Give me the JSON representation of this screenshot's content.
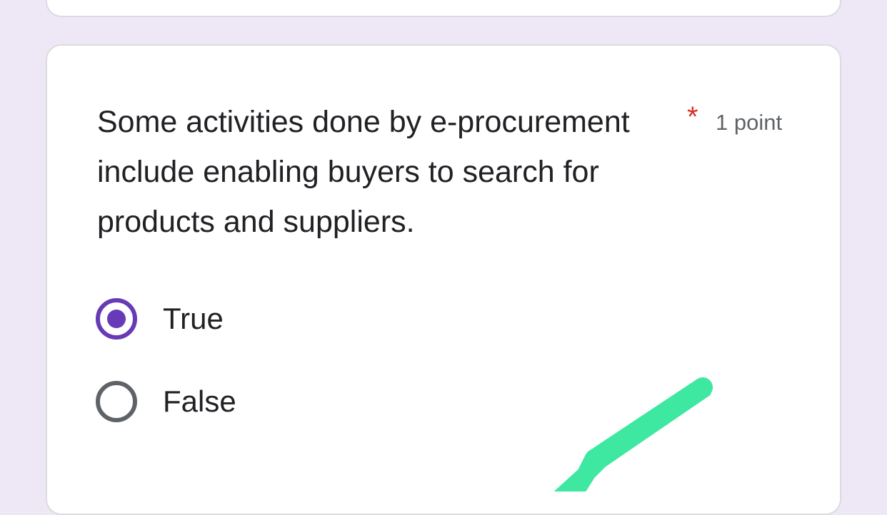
{
  "question": {
    "text": "Some activities done by e-procurement include enabling buyers to search for products and suppliers.",
    "required_marker": "*",
    "points": "1 point"
  },
  "options": [
    {
      "label": "True",
      "selected": true
    },
    {
      "label": "False",
      "selected": false
    }
  ],
  "colors": {
    "page_background": "#ede7f6",
    "accent": "#673ab7",
    "required": "#d93025",
    "marker": "#3ee8a0"
  },
  "annotation": {
    "icon": "green-checkmark-scribble"
  }
}
